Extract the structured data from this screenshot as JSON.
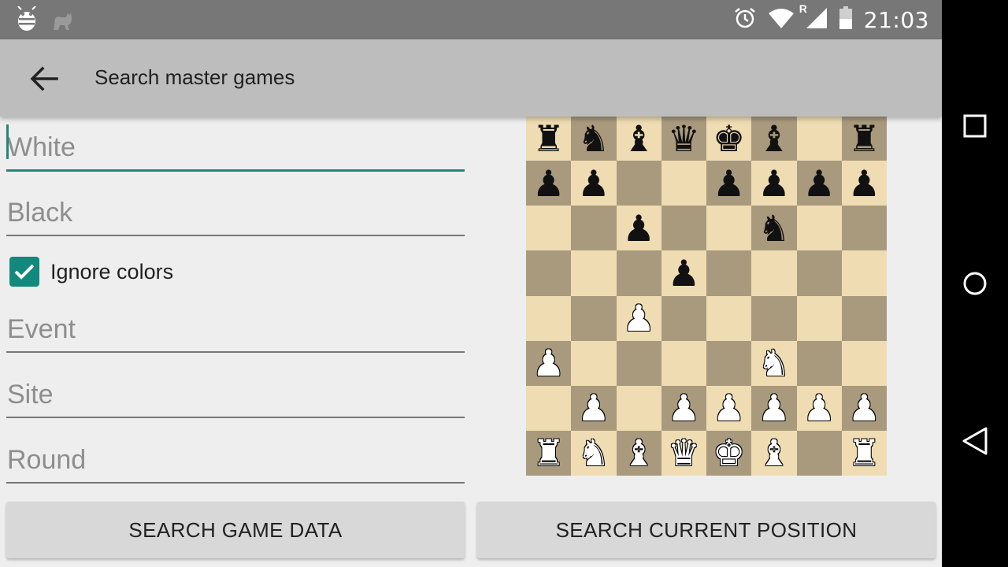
{
  "statusbar": {
    "time": "21:03",
    "icons": [
      "debug-bug-icon",
      "cat-icon",
      "alarm-icon",
      "wifi-icon",
      "signal-icon",
      "battery-icon"
    ],
    "roaming_indicator": "R"
  },
  "appbar": {
    "title": "Search master games",
    "back_icon": "arrow-left-icon"
  },
  "form": {
    "white_placeholder": "White",
    "black_placeholder": "Black",
    "ignore_colors_label": "Ignore colors",
    "ignore_colors_checked": true,
    "event_placeholder": "Event",
    "site_placeholder": "Site",
    "round_placeholder": "Round"
  },
  "buttons": {
    "search_game_data": "SEARCH GAME DATA",
    "search_current_position": "SEARCH CURRENT POSITION"
  },
  "board": {
    "ranks": [
      [
        "r",
        "n",
        "b",
        "q",
        "k",
        "b",
        "",
        "r"
      ],
      [
        "p",
        "p",
        "",
        "",
        "p",
        "p",
        "p",
        "p"
      ],
      [
        "",
        "",
        "p",
        "",
        "",
        "n",
        "",
        ""
      ],
      [
        "",
        "",
        "",
        "p",
        "",
        "",
        "",
        ""
      ],
      [
        "",
        "",
        "P",
        "",
        "",
        "",
        "",
        ""
      ],
      [
        "P",
        "",
        "",
        "",
        "",
        "N",
        "",
        ""
      ],
      [
        "",
        "P",
        "",
        "P",
        "P",
        "P",
        "P",
        "P"
      ],
      [
        "R",
        "N",
        "B",
        "Q",
        "K",
        "B",
        "",
        "R"
      ]
    ]
  },
  "navbar": {
    "icons": [
      "recent-apps-icon",
      "home-icon",
      "back-triangle-icon"
    ]
  },
  "colors": {
    "accent": "#26857a",
    "checkbox": "#11897c",
    "appbar": "#bdbdbd",
    "statusbar": "#777777",
    "board_light": "#efdcb2",
    "board_dark": "#a99a7e"
  }
}
